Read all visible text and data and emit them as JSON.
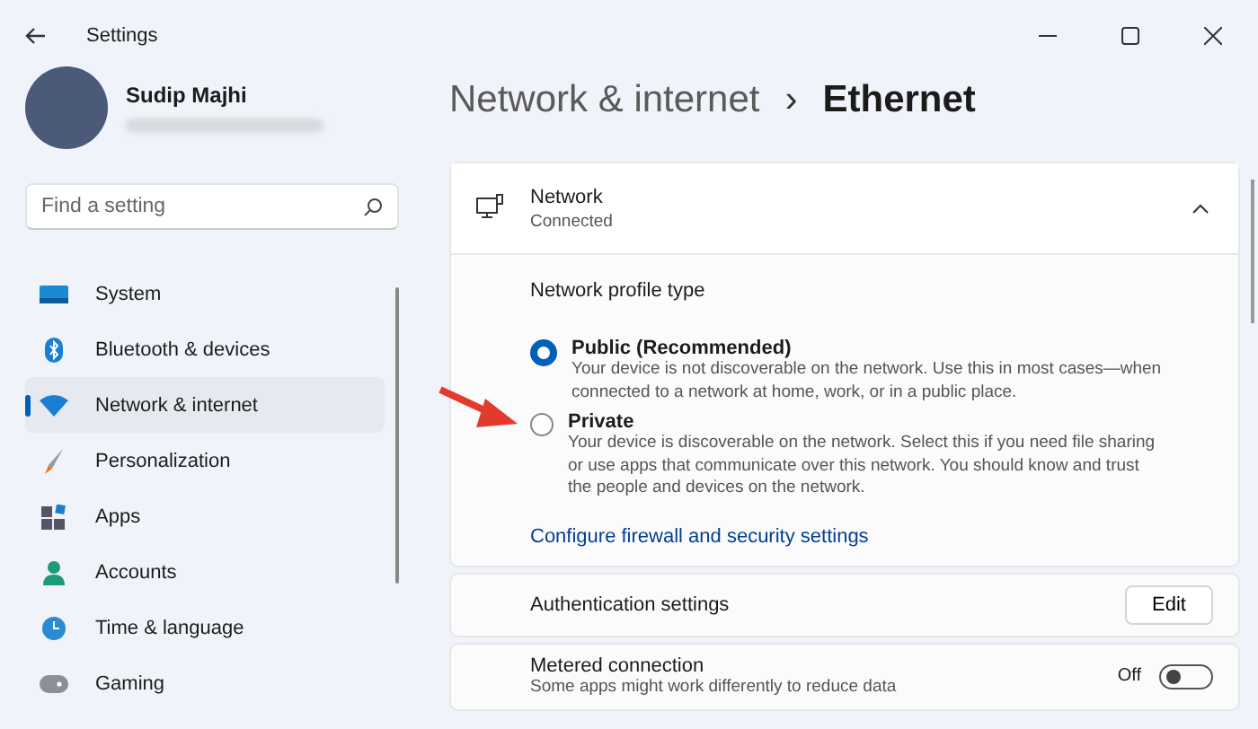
{
  "window": {
    "title": "Settings"
  },
  "user": {
    "name": "Sudip Majhi"
  },
  "search": {
    "placeholder": "Find a setting"
  },
  "sidebar": {
    "items": [
      {
        "label": "System",
        "selected": false
      },
      {
        "label": "Bluetooth & devices",
        "selected": false
      },
      {
        "label": "Network & internet",
        "selected": true
      },
      {
        "label": "Personalization",
        "selected": false
      },
      {
        "label": "Apps",
        "selected": false
      },
      {
        "label": "Accounts",
        "selected": false
      },
      {
        "label": "Time & language",
        "selected": false
      },
      {
        "label": "Gaming",
        "selected": false
      }
    ]
  },
  "breadcrumb": {
    "parent": "Network & internet",
    "separator": "›",
    "current": "Ethernet"
  },
  "network_card": {
    "title": "Network",
    "status": "Connected",
    "expanded": true,
    "profile_heading": "Network profile type",
    "options": [
      {
        "label": "Public (Recommended)",
        "description": "Your device is not discoverable on the network. Use this in most cases—when connected to a network at home, work, or in a public place.",
        "selected": true
      },
      {
        "label": "Private",
        "description": "Your device is discoverable on the network. Select this if you need file sharing or use apps that communicate over this network. You should know and trust the people and devices on the network.",
        "selected": false
      }
    ],
    "link": "Configure firewall and security settings"
  },
  "authentication": {
    "label": "Authentication settings",
    "button": "Edit"
  },
  "metered": {
    "label": "Metered connection",
    "description": "Some apps might work differently to reduce data",
    "state_label": "Off",
    "on": false
  }
}
